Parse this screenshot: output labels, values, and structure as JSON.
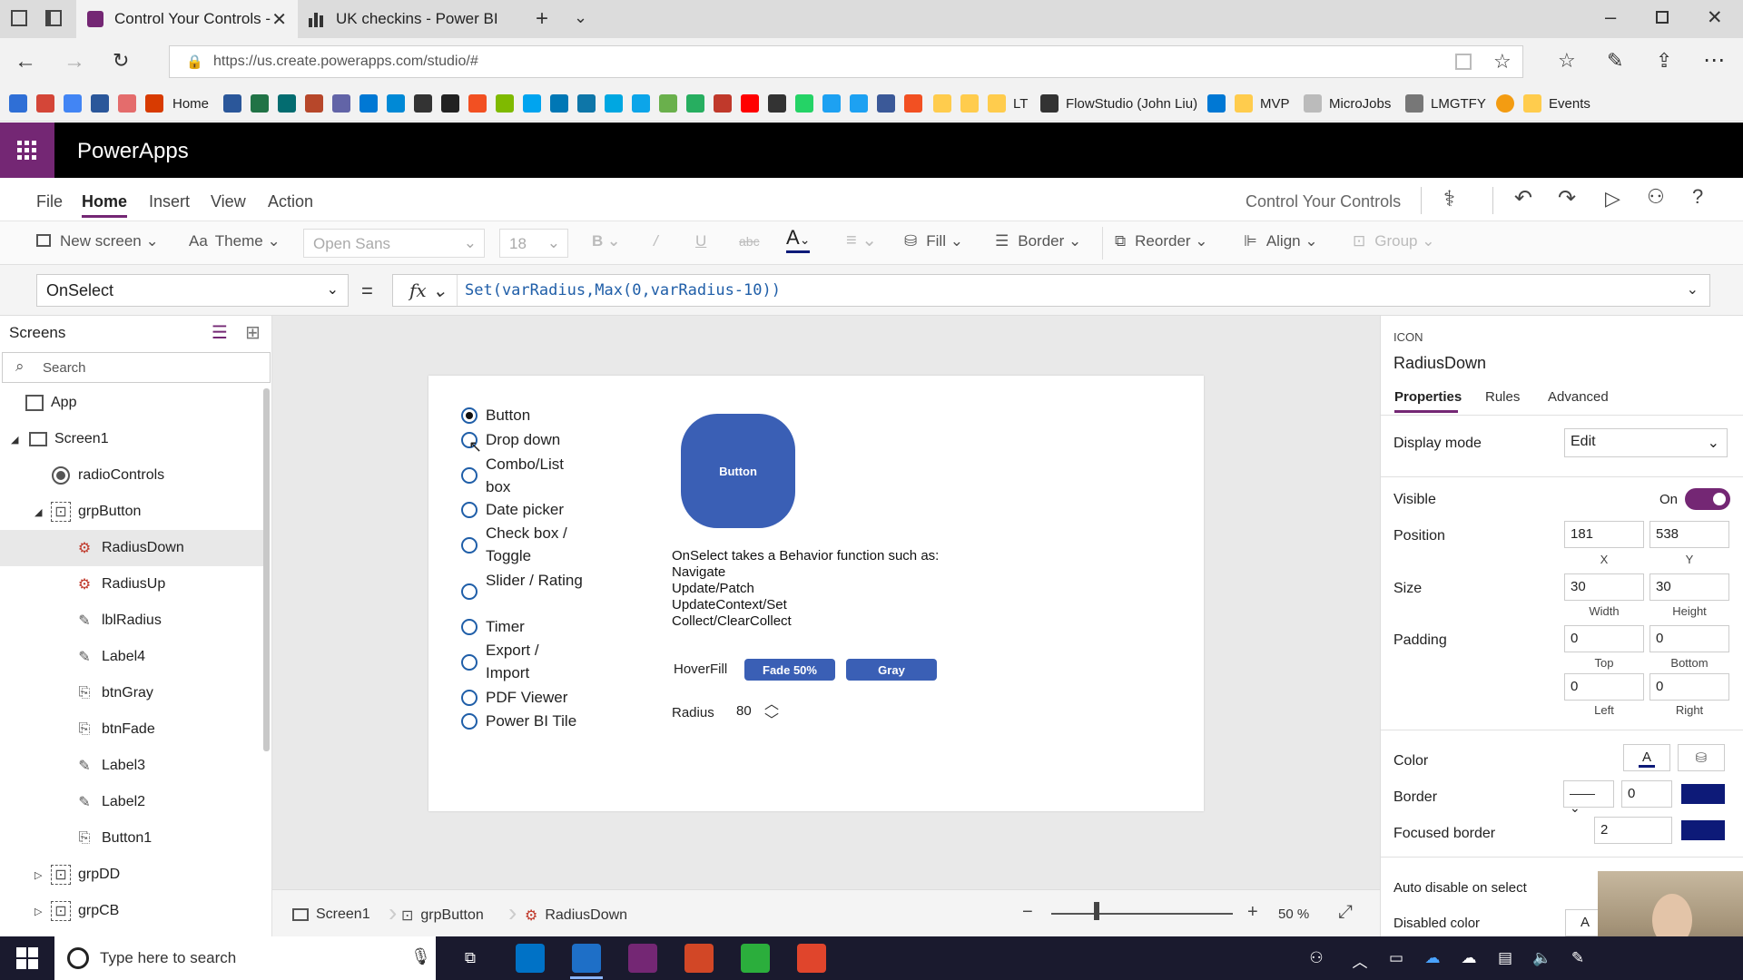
{
  "browser": {
    "tabs": [
      {
        "title": "Control Your Controls -",
        "active": true
      },
      {
        "title": "UK checkins - Power BI",
        "active": false
      }
    ],
    "url": "https://us.create.powerapps.com/studio/#",
    "favorites": [
      "Home",
      "LT",
      "FlowStudio (John Liu)",
      "MVP",
      "MicroJobs",
      "LMGTFY",
      "Events"
    ]
  },
  "app": {
    "name": "PowerApps",
    "project_name": "Control Your Controls"
  },
  "menu": {
    "items": [
      "File",
      "Home",
      "Insert",
      "View",
      "Action"
    ],
    "active": "Home"
  },
  "ribbon": {
    "new_screen": "New screen",
    "theme": "Theme",
    "font": "Open Sans",
    "font_size": "18",
    "bold": "B",
    "italic": "/",
    "underline": "U",
    "strike": "abc",
    "font_color": "A",
    "fill": "Fill",
    "border": "Border",
    "reorder": "Reorder",
    "align": "Align",
    "group": "Group"
  },
  "formula": {
    "property": "OnSelect",
    "equals": "=",
    "fx": "fx",
    "expression": "Set(varRadius,Max(0,varRadius-10))"
  },
  "screens_panel": {
    "title": "Screens",
    "search_placeholder": "Search",
    "tree": [
      {
        "label": "App",
        "icon": "app-icon",
        "indent": 0
      },
      {
        "label": "Screen1",
        "icon": "screen-icon",
        "indent": 1
      },
      {
        "label": "radioControls",
        "icon": "radio-icon",
        "indent": 2
      },
      {
        "label": "grpButton",
        "icon": "group-icon",
        "indent": 2
      },
      {
        "label": "RadiusDown",
        "icon": "icon-control-icon",
        "indent": 3,
        "selected": true
      },
      {
        "label": "RadiusUp",
        "icon": "icon-control-icon",
        "indent": 3
      },
      {
        "label": "lblRadius",
        "icon": "label-icon",
        "indent": 3
      },
      {
        "label": "Label4",
        "icon": "label-icon",
        "indent": 3
      },
      {
        "label": "btnGray",
        "icon": "button-icon",
        "indent": 3
      },
      {
        "label": "btnFade",
        "icon": "button-icon",
        "indent": 3
      },
      {
        "label": "Label3",
        "icon": "label-icon",
        "indent": 3
      },
      {
        "label": "Label2",
        "icon": "label-icon",
        "indent": 3
      },
      {
        "label": "Button1",
        "icon": "button-icon",
        "indent": 3
      },
      {
        "label": "grpDD",
        "icon": "group-icon",
        "indent": 2
      },
      {
        "label": "grpCB",
        "icon": "group-icon",
        "indent": 2
      }
    ]
  },
  "canvas": {
    "radio_options": [
      {
        "label": "Button",
        "selected": true
      },
      {
        "label": "Drop down",
        "selected": false
      },
      {
        "label": "Combo/List box",
        "selected": false
      },
      {
        "label": "Date picker",
        "selected": false
      },
      {
        "label": "Check box / Toggle",
        "selected": false
      },
      {
        "label": "Slider / Rating",
        "selected": false
      },
      {
        "label": "Timer",
        "selected": false
      },
      {
        "label": "Export / Import",
        "selected": false
      },
      {
        "label": "PDF Viewer",
        "selected": false
      },
      {
        "label": "Power BI Tile",
        "selected": false
      }
    ],
    "big_button_label": "Button",
    "description_lines": [
      "OnSelect takes a Behavior function such as:",
      "Navigate",
      "Update/Patch",
      "UpdateContext/Set",
      "Collect/ClearCollect"
    ],
    "hoverfill_label": "HoverFill",
    "fade_button_label": "Fade 50%",
    "gray_button_label": "Gray",
    "radius_label": "Radius",
    "radius_value": "80"
  },
  "statusbar": {
    "crumbs": [
      "Screen1",
      "grpButton",
      "RadiusDown"
    ],
    "zoom_value": "50",
    "zoom_unit": "%"
  },
  "properties": {
    "type": "ICON",
    "name": "RadiusDown",
    "tabs": [
      "Properties",
      "Rules",
      "Advanced"
    ],
    "active_tab": "Properties",
    "display_mode_label": "Display mode",
    "display_mode_value": "Edit",
    "visible_label": "Visible",
    "visible_value": "On",
    "position_label": "Position",
    "position_x": "181",
    "position_y": "538",
    "x_label": "X",
    "y_label": "Y",
    "size_label": "Size",
    "width": "30",
    "height": "30",
    "width_label": "Width",
    "height_label": "Height",
    "padding_label": "Padding",
    "padding_top": "0",
    "padding_bottom": "0",
    "padding_left": "0",
    "padding_right": "0",
    "top_label": "Top",
    "bottom_label": "Bottom",
    "left_label": "Left",
    "right_label": "Right",
    "color_label": "Color",
    "color_glyph": "A",
    "border_label": "Border",
    "border_value": "0",
    "focused_border_label": "Focused border",
    "focused_border_value": "2",
    "auto_disable_label": "Auto disable on select",
    "disabled_color_label": "Disabled color",
    "disabled_color_glyph": "A",
    "accent_color": "#742774",
    "border_color": "#0d1a78"
  },
  "taskbar": {
    "search_placeholder": "Type here to search"
  }
}
